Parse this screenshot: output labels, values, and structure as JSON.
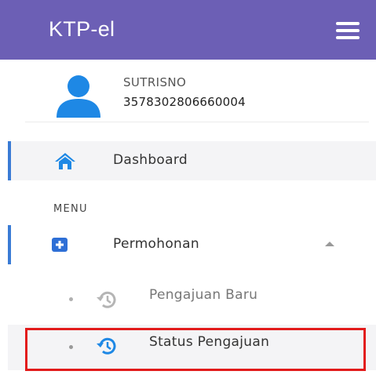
{
  "header": {
    "brand": "KTP-el"
  },
  "user": {
    "name": "SUTRISNO",
    "nik": "3578302806660004"
  },
  "nav": {
    "dashboard": {
      "label": "Dashboard"
    },
    "section_label": "MENU",
    "permohonan": {
      "label": "Permohonan",
      "children": [
        {
          "label": "Pengajuan Baru"
        },
        {
          "label": "Status Pengajuan"
        }
      ]
    }
  },
  "colors": {
    "header": "#6c5fb5",
    "accent": "#3a7bd5",
    "icon_blue": "#2e6fd6",
    "highlight_border": "#e21b1b"
  },
  "icons": {
    "menu": "hamburger-icon",
    "avatar": "user-icon",
    "dashboard": "home-icon",
    "permohonan": "plus-square-icon",
    "submenu": "history-icon",
    "expand": "caret-up-icon"
  }
}
